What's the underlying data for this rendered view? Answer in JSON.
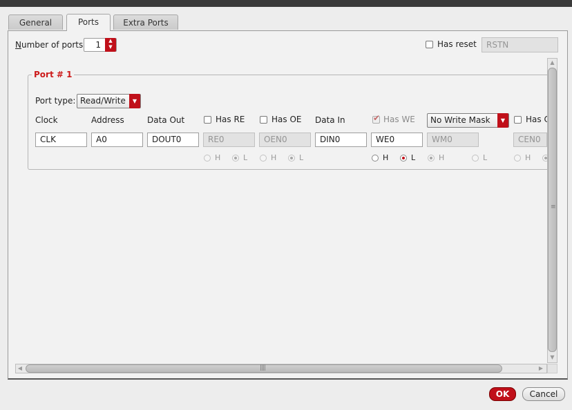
{
  "tabs": [
    {
      "label": "General",
      "active": false
    },
    {
      "label": "Ports",
      "active": true
    },
    {
      "label": "Extra Ports",
      "active": false
    }
  ],
  "num_ports": {
    "label_mnemonic": "N",
    "label_rest": "umber of ports:",
    "value": "1"
  },
  "has_reset": {
    "label": "Has reset",
    "checked": false,
    "value": "RSTN"
  },
  "port_group": {
    "title": "Port # 1"
  },
  "port_type": {
    "label": "Port type:",
    "value": "Read/Write"
  },
  "headers": {
    "clock": "Clock",
    "address": "Address",
    "data_out": "Data Out",
    "has_re": "Has RE",
    "has_oe": "Has OE",
    "data_in": "Data In",
    "has_we": "Has WE",
    "has_ce": "Has C"
  },
  "write_mask": {
    "value": "No Write Mask"
  },
  "fields": {
    "clock": "CLK",
    "address": "A0",
    "data_out": "DOUT0",
    "re": "RE0",
    "oe": "OEN0",
    "data_in": "DIN0",
    "we": "WE0",
    "wm": "WM0",
    "ce": "CEN0"
  },
  "radio": {
    "high": "H",
    "low": "L"
  },
  "buttons": {
    "ok": "OK",
    "cancel": "Cancel"
  },
  "colors": {
    "accent": "#c0101a",
    "group_title": "#cc1a1a"
  }
}
